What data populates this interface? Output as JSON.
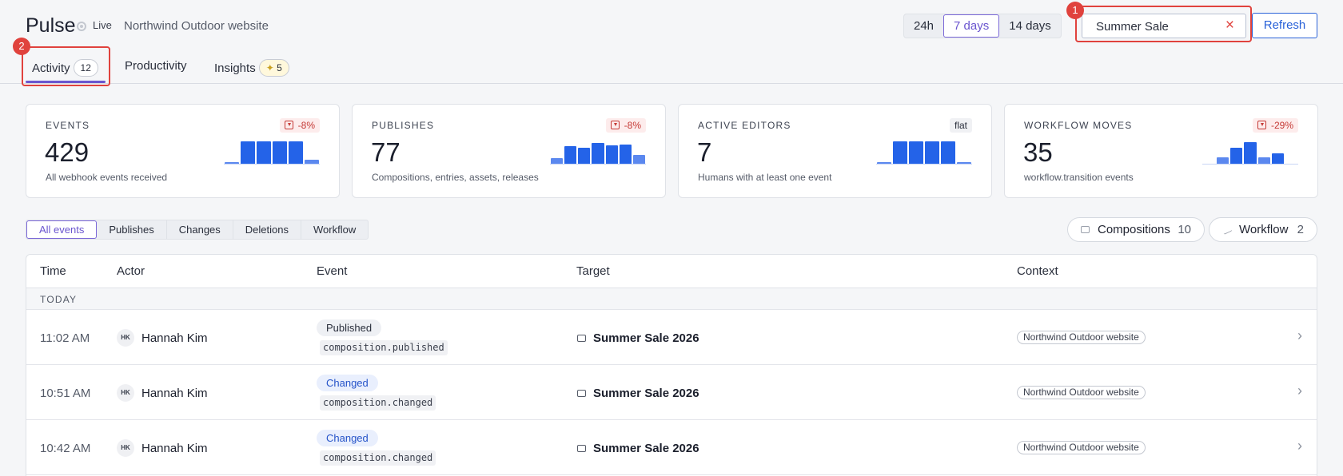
{
  "app": {
    "title": "Pulse",
    "live_label": "Live",
    "site_name": "Northwind Outdoor website"
  },
  "time_range": {
    "options": [
      "24h",
      "7 days",
      "14 days"
    ],
    "selected": "7 days"
  },
  "search": {
    "value": "Summer Sale",
    "clear_icon": "×"
  },
  "refresh_label": "Refresh",
  "callouts": [
    "1",
    "2"
  ],
  "tabs": [
    {
      "label": "Activity",
      "count": "12",
      "active": true
    },
    {
      "label": "Productivity"
    },
    {
      "label": "Insights",
      "count": "5",
      "icon": "wand-icon"
    }
  ],
  "kpis": [
    {
      "label": "EVENTS",
      "value": "429",
      "desc": "All webhook events received",
      "delta": "-8%",
      "trend": "down",
      "spark": [
        2,
        28,
        28,
        28,
        28,
        5
      ]
    },
    {
      "label": "PUBLISHES",
      "value": "77",
      "desc": "Compositions, entries, assets, releases",
      "delta": "-8%",
      "trend": "down",
      "spark": [
        7,
        22,
        20,
        26,
        23,
        24,
        11
      ]
    },
    {
      "label": "ACTIVE EDITORS",
      "value": "7",
      "desc": "Humans with at least one event",
      "delta": "flat",
      "trend": "flat",
      "spark": [
        2,
        28,
        28,
        28,
        28,
        2
      ]
    },
    {
      "label": "WORKFLOW MOVES",
      "value": "35",
      "desc": "workflow.transition events",
      "delta": "-29%",
      "trend": "down",
      "spark": [
        0,
        8,
        20,
        27,
        8,
        13,
        0
      ]
    }
  ],
  "filters": {
    "chips": [
      "All events",
      "Publishes",
      "Changes",
      "Deletions",
      "Workflow"
    ],
    "selected": "All events",
    "pills": [
      {
        "label": "Compositions",
        "count": "10",
        "icon": "composition-icon"
      },
      {
        "label": "Workflow",
        "count": "2",
        "icon": "workflow-icon"
      }
    ]
  },
  "table": {
    "columns": [
      "Time",
      "Actor",
      "Event",
      "Target",
      "Context"
    ],
    "group_label": "TODAY",
    "rows": [
      {
        "time": "11:02 AM",
        "initials": "HK",
        "actor": "Hannah Kim",
        "event": "Published",
        "event_type": "published",
        "code": "composition.published",
        "target": "Summer Sale 2026",
        "context": "Northwind Outdoor website"
      },
      {
        "time": "10:51 AM",
        "initials": "HK",
        "actor": "Hannah Kim",
        "event": "Changed",
        "event_type": "changed",
        "code": "composition.changed",
        "target": "Summer Sale 2026",
        "context": "Northwind Outdoor website"
      },
      {
        "time": "10:42 AM",
        "initials": "HK",
        "actor": "Hannah Kim",
        "event": "Changed",
        "event_type": "changed",
        "code": "composition.changed",
        "target": "Summer Sale 2026",
        "context": "Northwind Outdoor website"
      }
    ]
  },
  "colors": {
    "accent": "#6a55cf",
    "primary": "#2a62d8",
    "danger": "#e0423d",
    "spark_bar": "#2463e8"
  }
}
